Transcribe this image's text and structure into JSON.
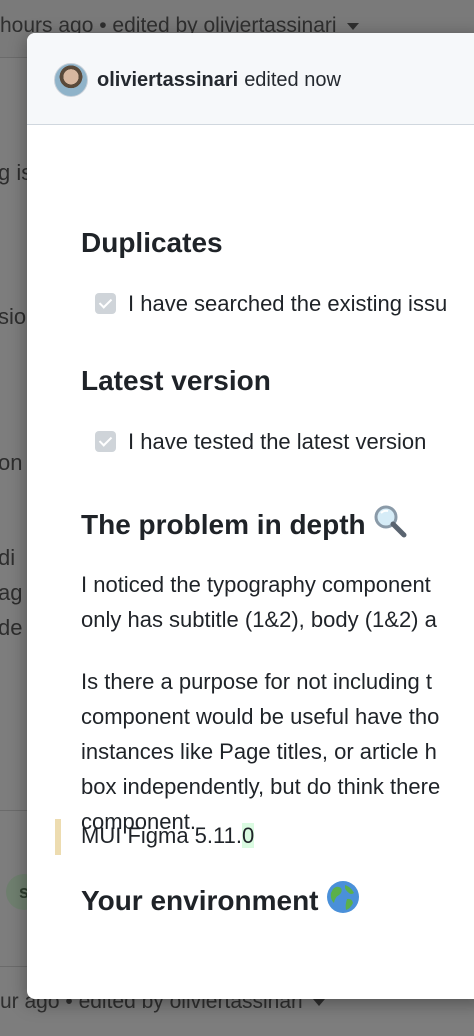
{
  "background": {
    "header_text": "hours ago • edited by oliviertassinari",
    "footer_text": "ur ago • edited by oliviertassinari",
    "side_fragments": [
      "g is",
      "sio",
      "on",
      "di",
      "ag",
      "de"
    ],
    "avatar_letter": "s"
  },
  "modal": {
    "editor": "oliviertassinari",
    "action": "edited now"
  },
  "sections": {
    "duplicates_heading": "Duplicates",
    "duplicates_task": "I have searched the existing issu",
    "latest_heading": "Latest version",
    "latest_task": "I have tested the latest version",
    "problem_heading": "The problem in depth",
    "problem_p1_line1": "I noticed the typography component",
    "problem_p1_line2": "only has subtitle (1&2), body (1&2) a",
    "problem_p2_line1": "Is there a purpose for not including t",
    "problem_p2_line2": "component would be useful have tho",
    "problem_p2_line3": "instances like Page titles, or article h",
    "problem_p2_line4": "box independently, but do think there",
    "problem_p2_line5": "component.",
    "env_heading": "Your environment",
    "env_text_prefix": "MUI Figma 5.11.",
    "env_text_added": "0"
  },
  "icons": {
    "problem_heading_icon": "magnifying-glass-emoji-icon",
    "env_heading_icon": "globe-emoji-icon"
  },
  "colors": {
    "quote_bar": "#eddcb0",
    "added_highlight": "#dafbe1",
    "checkbox": "#cfd4d9"
  }
}
